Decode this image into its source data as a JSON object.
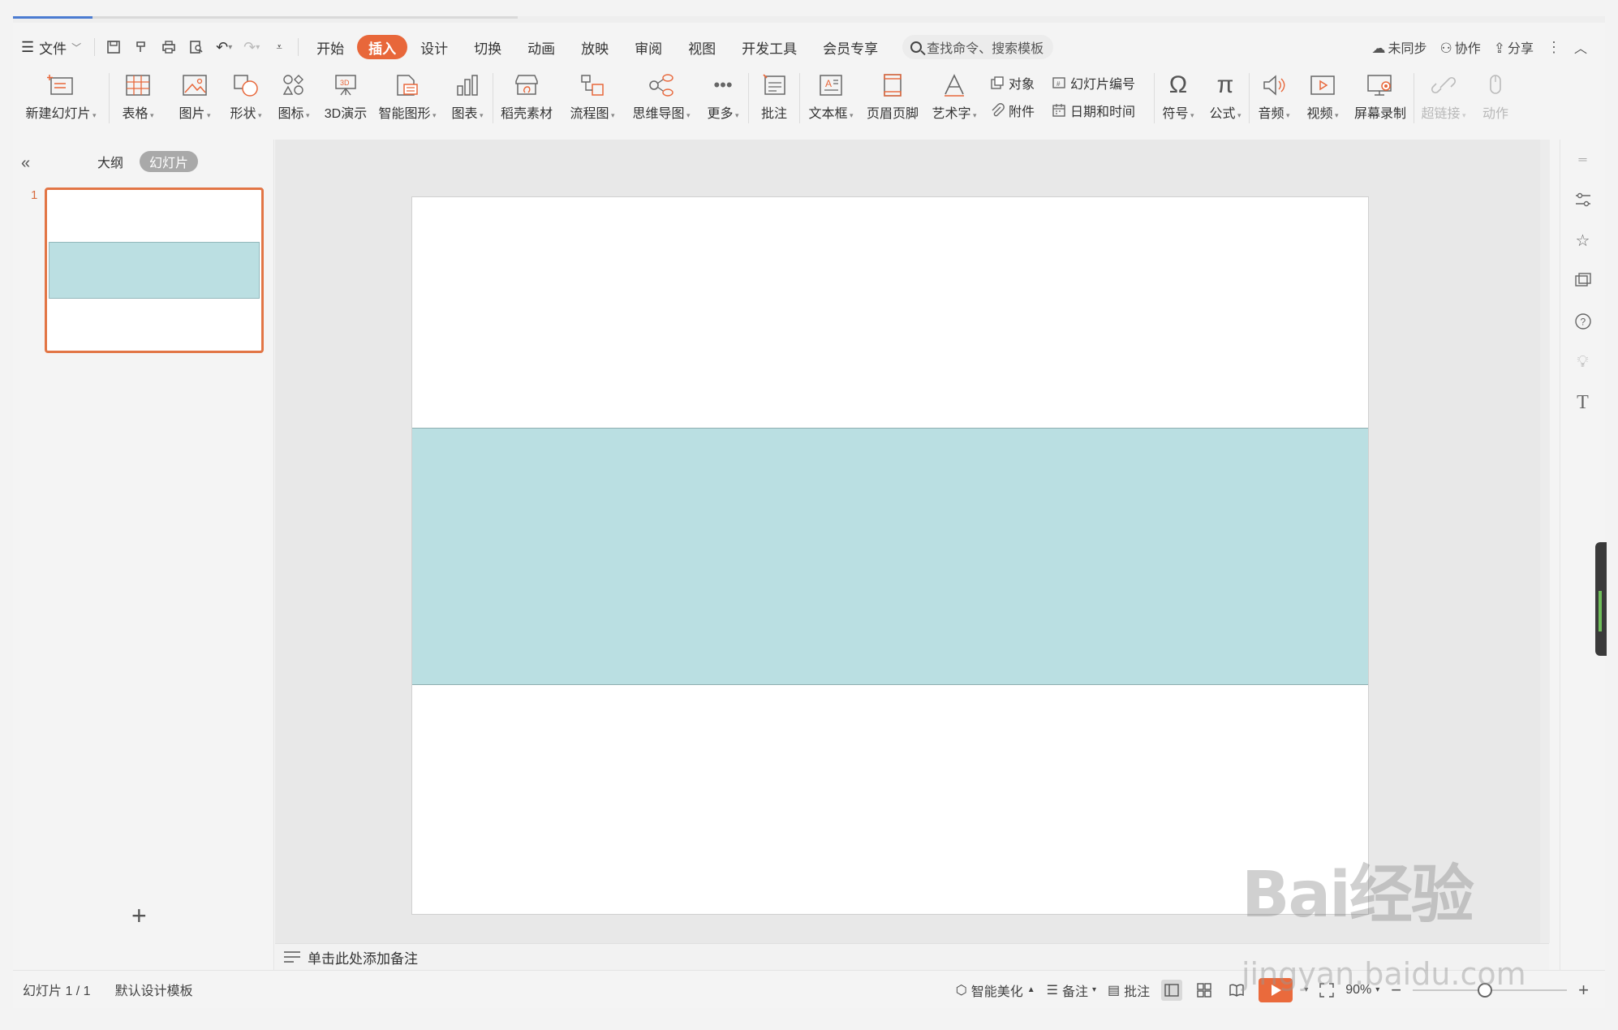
{
  "menubar": {
    "file": "文件",
    "tabs": [
      "开始",
      "插入",
      "设计",
      "切换",
      "动画",
      "放映",
      "审阅",
      "视图",
      "开发工具",
      "会员专享"
    ],
    "active_tab": "插入",
    "search_placeholder": "查找命令、搜索模板",
    "sync": "未同步",
    "collab": "协作",
    "share": "分享"
  },
  "ribbon": {
    "new_slide": "新建幻灯片",
    "table": "表格",
    "picture": "图片",
    "shape": "形状",
    "icon": "图标",
    "demo3d": "3D演示",
    "smartart": "智能图形",
    "chart": "图表",
    "material": "稻壳素材",
    "flowchart": "流程图",
    "mindmap": "思维导图",
    "more": "更多",
    "comment": "批注",
    "textbox": "文本框",
    "header_footer": "页眉页脚",
    "wordart": "艺术字",
    "object": "对象",
    "slide_number": "幻灯片编号",
    "attachment": "附件",
    "datetime": "日期和时间",
    "symbol": "符号",
    "formula": "公式",
    "audio": "音频",
    "video": "视频",
    "screen_record": "屏幕录制",
    "hyperlink": "超链接",
    "action": "动作"
  },
  "leftpane": {
    "outline_tab": "大纲",
    "slides_tab": "幻灯片",
    "slide_number": "1",
    "add": "+"
  },
  "notes_placeholder": "单击此处添加备注",
  "statusbar": {
    "slide_info": "幻灯片 1 / 1",
    "template": "默认设计模板",
    "beautify": "智能美化",
    "notes": "备注",
    "comments": "批注",
    "zoom": "90%"
  },
  "watermark": {
    "logo_text": "Bai经验",
    "url": "jingyan.baidu.com"
  },
  "colors": {
    "accent": "#e8673a",
    "band": "#badfe2"
  }
}
